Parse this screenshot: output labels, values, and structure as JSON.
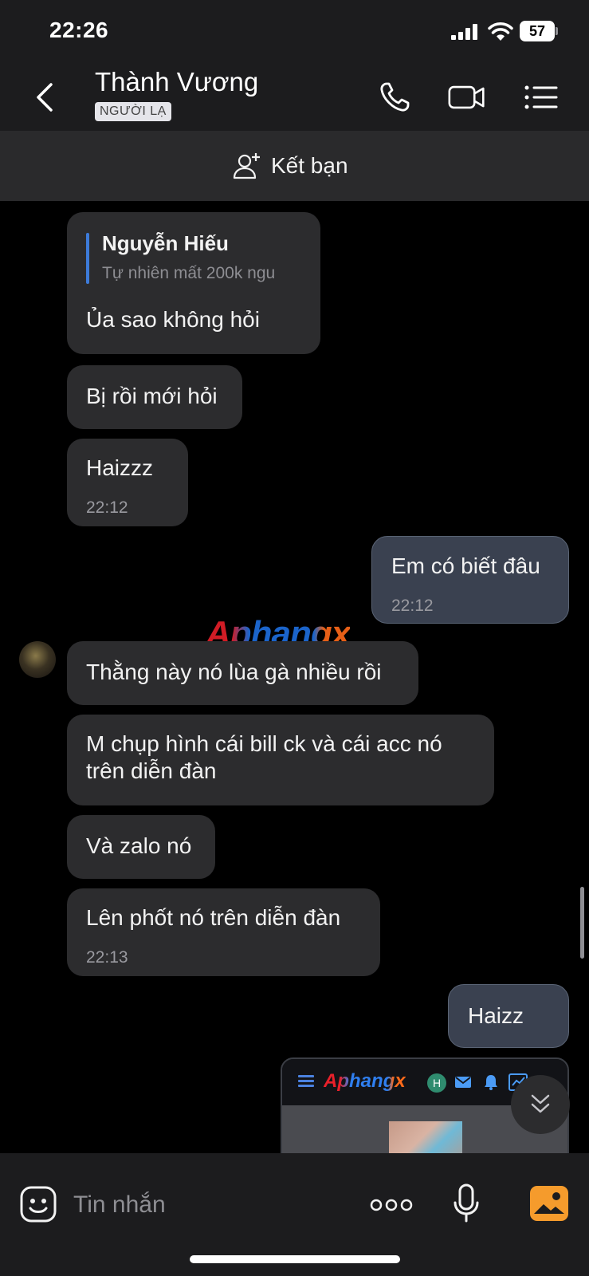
{
  "status_bar": {
    "time": "22:26",
    "battery": "57"
  },
  "header": {
    "title": "Thành Vương",
    "badge": "NGƯỜI LẠ",
    "icons": [
      "back-chevron-icon",
      "phone-icon",
      "video-camera-icon",
      "list-menu-icon"
    ]
  },
  "friend_bar": {
    "label": "Kết bạn",
    "icon": "add-person-icon"
  },
  "watermark": "Aphangx",
  "messages": [
    {
      "side": "left",
      "quote_name": "Nguyễn Hiếu",
      "quote_text": "Tự nhiên mất 200k ngu",
      "text": "Ủa sao không hỏi"
    },
    {
      "side": "left",
      "text": "Bị rồi mới hỏi"
    },
    {
      "side": "left",
      "text": "Haizzz",
      "time": "22:12"
    },
    {
      "side": "right",
      "text": "Em có biết đâu",
      "time": "22:12"
    },
    {
      "side": "left",
      "text": "Thằng này nó lùa gà nhiều rồi"
    },
    {
      "side": "left",
      "text_line1": "M chụp hình cái bill ck và cái acc nó",
      "text_line2": "trên diễn đàn"
    },
    {
      "side": "left",
      "text": "Và zalo nó"
    },
    {
      "side": "left",
      "text": "Lên phốt nó trên diễn đàn",
      "time": "22:13"
    },
    {
      "side": "right",
      "text": "Haizz"
    }
  ],
  "preview": {
    "logo": "Aphangx",
    "avatar_letter": "H"
  },
  "composer": {
    "placeholder": "Tin nhắn"
  }
}
